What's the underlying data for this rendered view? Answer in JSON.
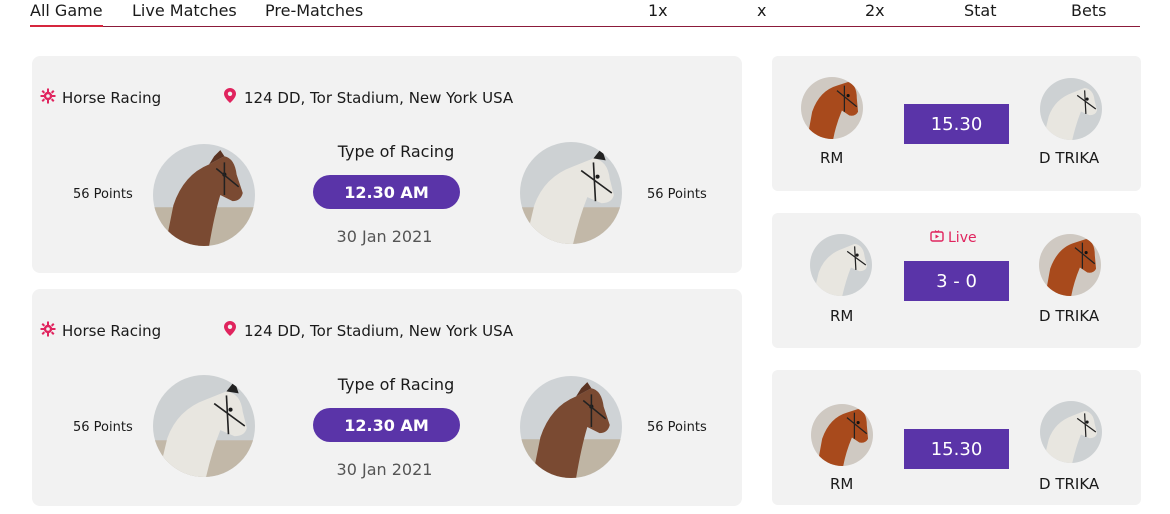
{
  "tabs": [
    "All Game",
    "Live Matches",
    "Pre-Matches"
  ],
  "columns": [
    "1x",
    "x",
    "2x",
    "Stat",
    "Bets"
  ],
  "matches": [
    {
      "sport": "Horse Racing",
      "location": "124 DD, Tor Stadium, New York USA",
      "left_points": "56 Points",
      "right_points": "56 Points",
      "type": "Type of Racing",
      "time": "12.30 AM",
      "date": "30 Jan 2021"
    },
    {
      "sport": "Horse Racing",
      "location": "124 DD, Tor Stadium, New York USA",
      "left_points": "56 Points",
      "right_points": "56 Points",
      "type": "Type of Racing",
      "time": "12.30 AM",
      "date": "30 Jan 2021"
    }
  ],
  "mini_matches": [
    {
      "left_team": "RM",
      "right_team": "D TRIKA",
      "score": "15.30",
      "live": ""
    },
    {
      "left_team": "RM",
      "right_team": "D TRIKA",
      "score": "3 - 0",
      "live": "Live"
    },
    {
      "left_team": "RM",
      "right_team": "D TRIKA",
      "score": "15.30",
      "live": ""
    }
  ],
  "colors": {
    "accent": "#5a34a8",
    "pin": "#e0245e",
    "tab_underline": "#d6263d"
  }
}
